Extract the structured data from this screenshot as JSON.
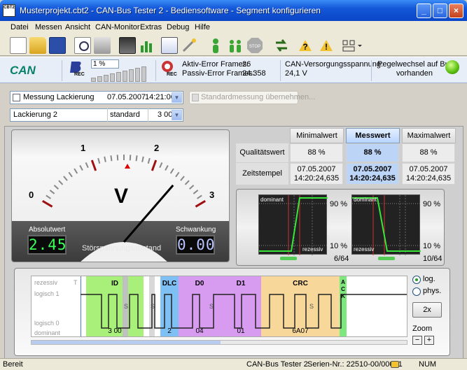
{
  "window": {
    "title": "Musterprojekt.cbt2 - CAN-Bus Tester 2 - Bediensoftware - Segment konfigurieren",
    "app_icon_text": "CBT2"
  },
  "menu": [
    "Datei",
    "Messen",
    "Ansicht",
    "CAN-Monitor",
    "Extras",
    "Debug",
    "Hilfe"
  ],
  "toolbar": {
    "icons": [
      "new-file-icon",
      "open-folder-icon",
      "save-icon",
      "print-preview-icon",
      "print-icon",
      "network-icon",
      "chart-icon",
      "report-icon",
      "wizard-icon",
      "person-icon",
      "people-icon",
      "stop-icon",
      "refresh-icon",
      "help-icon",
      "info-icon",
      "layout-icon"
    ],
    "stop_label": "STOP"
  },
  "status": {
    "can_logo": "CAN",
    "rec_label": "REC",
    "busload": "1 %",
    "aktiv_error_label": "Aktiv-Error Frames:",
    "aktiv_error_value": "26",
    "passiv_error_label": "Passiv-Error Frames:",
    "passiv_error_value": "24.358",
    "versorgung_label": "CAN-Versorgungsspannung:",
    "versorgung_value": "24,1 V",
    "pegelwechsel_line1": "Pegelwechsel auf Bus",
    "pegelwechsel_line2": "vorhanden"
  },
  "measurement": {
    "name": "Messung Lackierung",
    "date": "07.05.2007",
    "time": "14:21:00",
    "std_button": "Standardmessung übernehmen...",
    "segment": "Lackierung 2",
    "mode": "standard",
    "rate": "3 00"
  },
  "meter": {
    "scale_labels": [
      "0",
      "1",
      "2",
      "3"
    ],
    "unit": "V",
    "needle_value": 2.45,
    "absolut_label": "Absolutwert",
    "absolut_value": "2.45",
    "schwankung_label": "Schwankung",
    "schwankung_value": "0.00",
    "caption": "Störspannungsabstand"
  },
  "table": {
    "headers": [
      "Minimalwert",
      "Messwert",
      "Maximalwert"
    ],
    "rows": [
      {
        "label": "Qualitätswert",
        "values": [
          "88 %",
          "88 %",
          "88 %"
        ]
      },
      {
        "label": "Zeitstempel",
        "values": [
          [
            "07.05.2007",
            "14:20:24,635"
          ],
          [
            "07.05.2007",
            "14:20:24,635"
          ],
          [
            "07.05.2007",
            "14:20:24,635"
          ]
        ]
      }
    ]
  },
  "scope": {
    "dominant": "dominant",
    "rezessiv": "rezessiv",
    "pct_top": "90 %",
    "pct_bottom": "10 %",
    "left_count": "6/64",
    "right_count": "10/64"
  },
  "trace": {
    "level_labels": [
      "rezessiv",
      "logisch 1",
      "logisch 0",
      "dominant"
    ],
    "marker": "T",
    "segments": [
      {
        "name": "ID",
        "value": "3 00",
        "color": "#a8f07a"
      },
      {
        "name": "DLC",
        "value": "2",
        "color": "#7ec0f4"
      },
      {
        "name": "D0",
        "value": "04",
        "color": "#d79cf0"
      },
      {
        "name": "D1",
        "value": "01",
        "color": "#d79cf0"
      },
      {
        "name": "CRC",
        "value": "6A07",
        "color": "#f8d89a"
      },
      {
        "name": "A",
        "value": "",
        "color": "#7ee87e"
      }
    ],
    "stuff_bit": "S",
    "ack_letters": [
      "A",
      "C",
      "K"
    ],
    "options": {
      "log": "log.",
      "phys": "phys.",
      "factor": "2x",
      "zoom": "Zoom",
      "minus": "−",
      "plus": "+"
    }
  },
  "statusbar": {
    "left": "Bereit",
    "device": "CAN-Bus Tester 2",
    "serial": "Serien-Nr.: 22510-00/00001",
    "num": "NUM"
  },
  "colors": {
    "accent": "#0a46c8",
    "panel": "#d4d0c8",
    "green_led": "#5fc313",
    "lcd_green": "#3bff5a",
    "lcd_blue": "#b8c4ff"
  }
}
